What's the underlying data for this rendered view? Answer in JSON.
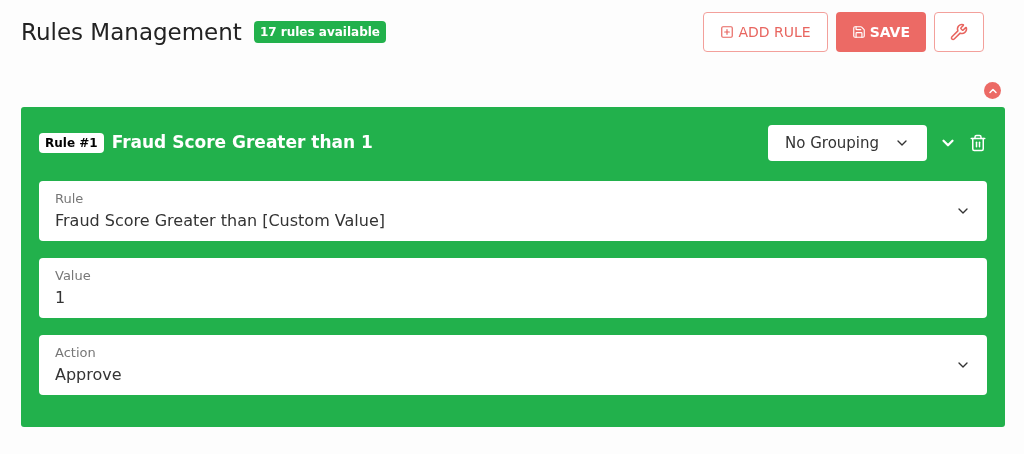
{
  "header": {
    "title": "Rules Management",
    "badge": "17 rules available"
  },
  "toolbar": {
    "add_label": "ADD RULE",
    "save_label": "SAVE"
  },
  "rules": [
    {
      "tag": "Rule #1",
      "name": "Fraud Score Greater than 1",
      "grouping": "No Grouping",
      "expanded": true,
      "fields": [
        {
          "kind": "select",
          "label": "Rule",
          "value": "Fraud Score Greater than [Custom Value]"
        },
        {
          "kind": "input",
          "label": "Value",
          "value": "1"
        },
        {
          "kind": "select",
          "label": "Action",
          "value": "Approve"
        }
      ]
    }
  ]
}
